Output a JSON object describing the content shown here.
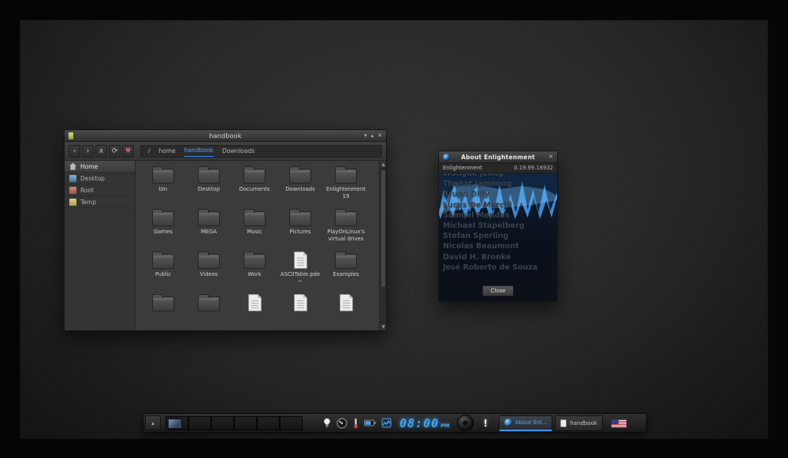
{
  "accent_color": "#3fa0f0",
  "icons": {
    "shade": "▾",
    "maximize": "▴",
    "close": "✕",
    "back": "‹",
    "forward": "›",
    "up": "∧",
    "refresh": "⟳",
    "favorites": "♥",
    "scroll_up": "▲",
    "scroll_down": "▼",
    "shelf_handle": "▴"
  },
  "file_manager": {
    "title": "handbook",
    "breadcrumb": {
      "items": [
        "/",
        "home",
        "handbook",
        "Downloads"
      ],
      "active_index": 2
    },
    "sidebar": {
      "selected_index": 0,
      "items": [
        {
          "label": "Home",
          "icon": "home"
        },
        {
          "label": "Desktop",
          "icon": "desktop"
        },
        {
          "label": "Root",
          "icon": "root"
        },
        {
          "label": "Temp",
          "icon": "temp"
        }
      ]
    },
    "grid": {
      "items": [
        {
          "label": "bin",
          "type": "folder"
        },
        {
          "label": "Desktop",
          "type": "folder"
        },
        {
          "label": "Documents",
          "type": "folder"
        },
        {
          "label": "Downloads",
          "type": "folder"
        },
        {
          "label": "Enlightenment\n19",
          "type": "folder"
        },
        {
          "label": "Games",
          "type": "folder"
        },
        {
          "label": "MEGA",
          "type": "folder"
        },
        {
          "label": "Music",
          "type": "folder"
        },
        {
          "label": "Pictures",
          "type": "folder"
        },
        {
          "label": "PlayOnLinux's\nvirtual drives",
          "type": "folder"
        },
        {
          "label": "Public",
          "type": "folder"
        },
        {
          "label": "Videos",
          "type": "folder"
        },
        {
          "label": "Work",
          "type": "folder"
        },
        {
          "label": "ASCIITable.pde\n~",
          "type": "file"
        },
        {
          "label": "Examples",
          "type": "folder"
        },
        {
          "label": "",
          "type": "folder"
        },
        {
          "label": "",
          "type": "folder"
        },
        {
          "label": "",
          "type": "file"
        },
        {
          "label": "",
          "type": "file"
        },
        {
          "label": "",
          "type": "file"
        }
      ]
    }
  },
  "about": {
    "title": "About Enlightenment",
    "app": "Enlightenment",
    "version": "0.19.99.18932",
    "credits": [
      "Wonguk Jeong",
      "Thanat Jamnong",
      "Bruno Dilly",
      "Lucas De Marchi",
      "Samuel Mendes",
      "Michael Stapelberg",
      "Stefan Sperling",
      "Nicolas Beaumont",
      "David H. Bronke",
      "José Roberto de Souza"
    ],
    "close_label": "Close"
  },
  "shelf": {
    "pager": {
      "slots": 6,
      "active_slot": 0
    },
    "gadgets": [
      "backlight",
      "cpufreq",
      "temperature",
      "battery",
      "cpumonitor"
    ],
    "clock": {
      "time": "08:00",
      "meridiem": "PM"
    },
    "alert": "!",
    "tasks": [
      {
        "label": "About Enl...",
        "icon": "enlightenment",
        "active": true
      },
      {
        "label": "handbook",
        "icon": "document",
        "active": false
      }
    ]
  }
}
